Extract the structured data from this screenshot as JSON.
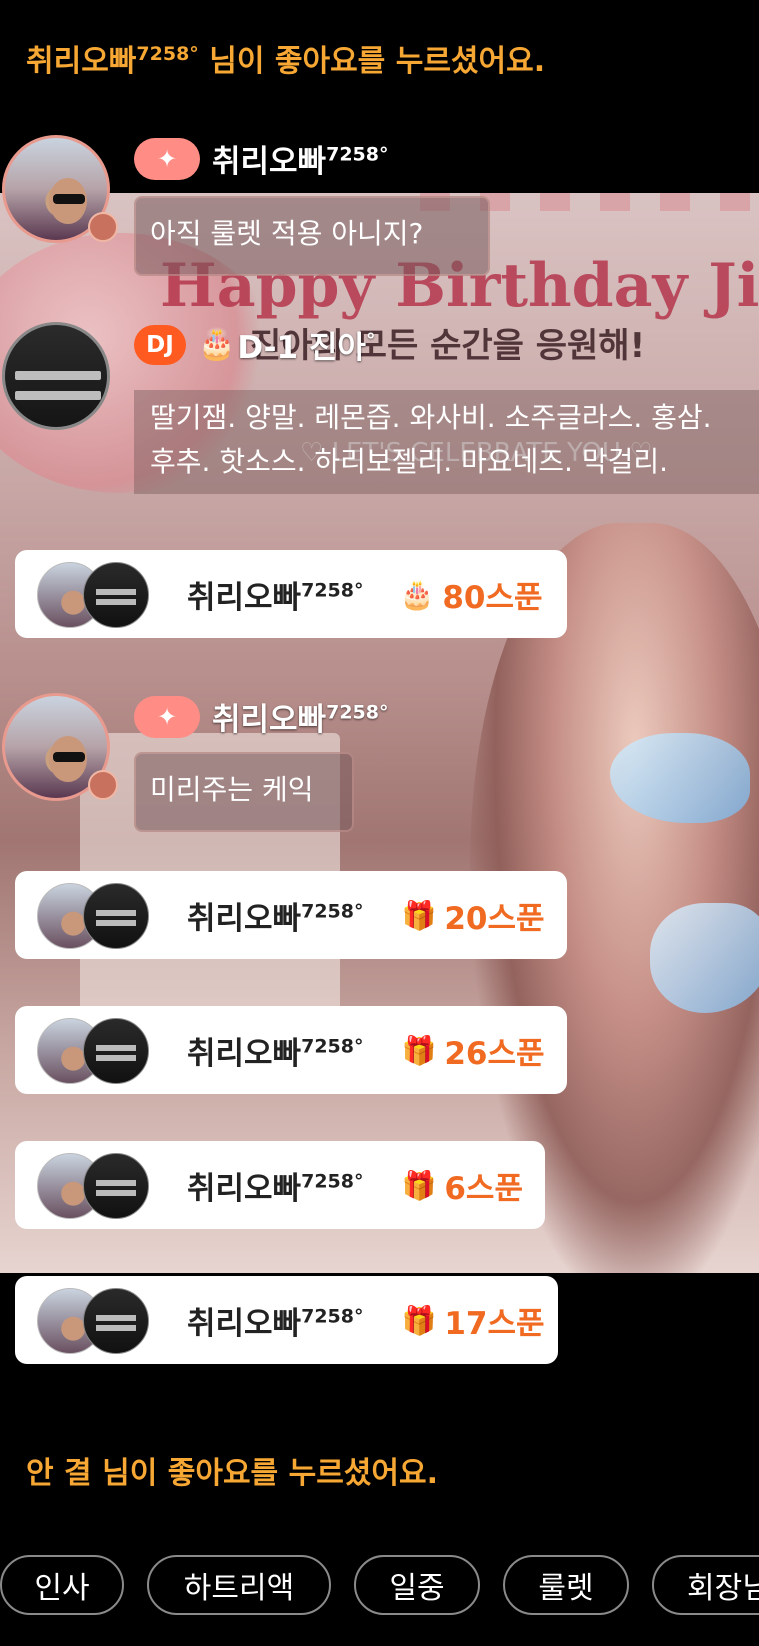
{
  "system_messages": [
    {
      "name": "취리오빠",
      "sup": "7258°",
      "text": " 님이 좋아요를 누르셨어요."
    },
    {
      "name": "안 결",
      "sup": "",
      "text": " 님이 좋아요를 누르셨어요."
    }
  ],
  "background": {
    "title": "Happy Birthday Jin",
    "subtitle": "진아의 모든 순간을 응원해!",
    "sub2": "♡ LET'S CELEBRATE YOU ♡"
  },
  "chat": [
    {
      "fan_icon": "✦",
      "nick": "취리오빠",
      "nick_sup": "7258°",
      "message": "아직  룰렛  적용  아니지?"
    },
    {
      "fan_icon": "✦",
      "nick": "취리오빠",
      "nick_sup": "7258°",
      "message": "미리주는  케익"
    }
  ],
  "dj": {
    "badge": "DJ",
    "cake_icon": "🎂",
    "nick": "D-1 진아",
    "nick_sup": "°",
    "line1": "딸기잼. 양말. 레몬즙. 와사비. 소주글라스. 홍삼.",
    "line2": "후추. 핫소스. 하리보젤리. 마요네즈. 막걸리."
  },
  "gifts": [
    {
      "nick": "취리오빠",
      "sup": "7258°",
      "icon": "🎂",
      "amount": "80스푼"
    },
    {
      "nick": "취리오빠",
      "sup": "7258°",
      "icon": "🎁",
      "amount": "20스푼"
    },
    {
      "nick": "취리오빠",
      "sup": "7258°",
      "icon": "🎁",
      "amount": "26스푼"
    },
    {
      "nick": "취리오빠",
      "sup": "7258°",
      "icon": "🎁",
      "amount": "6스푼"
    },
    {
      "nick": "취리오빠",
      "sup": "7258°",
      "icon": "🎁",
      "amount": "17스푼"
    }
  ],
  "quick_chips": [
    "인사",
    "하트리액",
    "일중",
    "룰렛",
    "회장님"
  ]
}
